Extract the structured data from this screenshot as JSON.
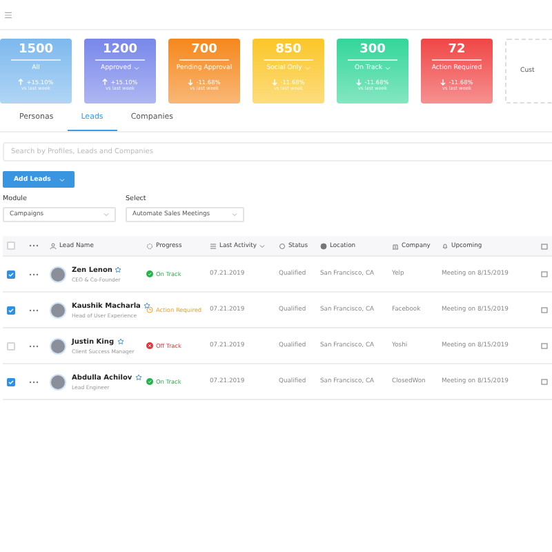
{
  "stat_cards": [
    {
      "value": "1500",
      "label": "All",
      "trend": "+15.10%",
      "kind": "up",
      "caption": "vs last week",
      "has_dropdown": false,
      "color": "#7db9ee"
    },
    {
      "value": "1200",
      "label": "Approved",
      "trend": "+15.10%",
      "kind": "up",
      "caption": "vs last week",
      "has_dropdown": true,
      "color": "#7887ea"
    },
    {
      "value": "700",
      "label": "Pending Approval",
      "trend": "-11.68%",
      "kind": "down",
      "caption": "vs last week",
      "has_dropdown": false,
      "color": "#f5871c"
    },
    {
      "value": "850",
      "label": "Social Only",
      "trend": "-11.68%",
      "kind": "down",
      "caption": "vs last week",
      "has_dropdown": true,
      "color": "#fbc628"
    },
    {
      "value": "300",
      "label": "On Track",
      "trend": "-11.68%",
      "kind": "down",
      "caption": "vs last week",
      "has_dropdown": true,
      "color": "#33d69a"
    },
    {
      "value": "72",
      "label": "Action Required",
      "trend": "-11.68%",
      "kind": "down",
      "caption": "vs last week",
      "has_dropdown": false,
      "color": "#f04646"
    }
  ],
  "custom_card": {
    "label": "Cust"
  },
  "tabs": [
    {
      "label": "Personas",
      "selected": false
    },
    {
      "label": "Leads",
      "selected": true
    },
    {
      "label": "Companies",
      "selected": false
    }
  ],
  "search": {
    "placeholder": "Search by Profiles, Leads and Companies"
  },
  "add_button": {
    "label": "Add Leads"
  },
  "filters": [
    {
      "label": "Module",
      "value": "Campaigns"
    },
    {
      "label": "Select",
      "value": "Automate Sales Meetings"
    }
  ],
  "table": {
    "all_checked": false,
    "columns": [
      "Lead Name",
      "Progress",
      "Last Activity",
      "Status",
      "Location",
      "Company",
      "Upcoming"
    ],
    "rows": [
      {
        "checked": true,
        "name": "Zen Lenon",
        "title": "CEO & Co-Founder",
        "progress": {
          "label": "On Track",
          "kind": "on_track"
        },
        "last_activity": "07.21.2019",
        "status": "Qualified",
        "location": "San Francisco, CA",
        "company": "Yelp",
        "upcoming": "Meeting on 8/15/2019"
      },
      {
        "checked": true,
        "name": "Kaushik Macharla",
        "title": "Head of User Experience",
        "progress": {
          "label": "Action Required",
          "kind": "action_required"
        },
        "last_activity": "07.21.2019",
        "status": "Qualified",
        "location": "San Francisco, CA",
        "company": "Facebook",
        "upcoming": "Meeting on 8/15/2019"
      },
      {
        "checked": false,
        "name": "Justin King",
        "title": "Client Success Manager",
        "progress": {
          "label": "Off Track",
          "kind": "off_track"
        },
        "last_activity": "07.21.2019",
        "status": "Qualified",
        "location": "San Francisco, CA",
        "company": "Yoshi",
        "upcoming": "Meeting on 8/15/2019"
      },
      {
        "checked": true,
        "name": "Abdulla Achilov",
        "title": "Lead Engineer",
        "progress": {
          "label": "On Track",
          "kind": "on_track"
        },
        "last_activity": "07.21.2019",
        "status": "Qualified",
        "location": "San Francisco, CA",
        "company": "ClosedWon",
        "upcoming": "Meeting on 8/15/2019"
      }
    ]
  }
}
